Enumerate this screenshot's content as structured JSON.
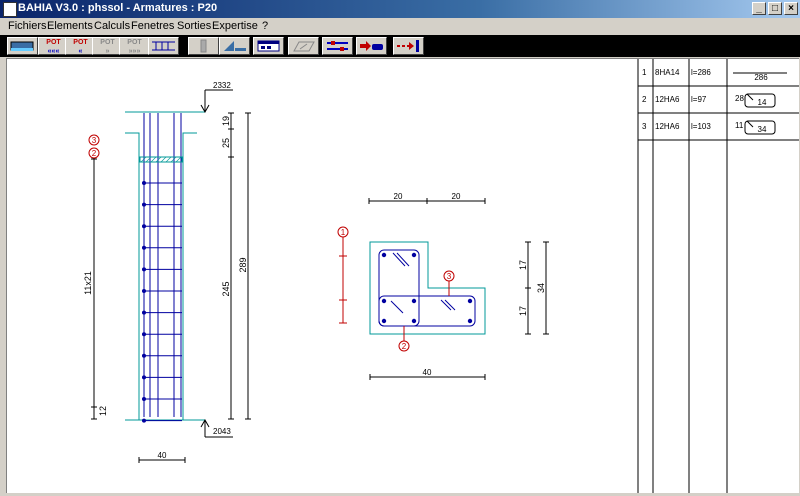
{
  "window": {
    "title": "BAHIA V3.0 : phssol - Armatures : P20",
    "minimize": "_",
    "maximize": "□",
    "close": "×"
  },
  "menu": [
    "Fichiers",
    "Elements",
    "Calculs",
    "Fenetres",
    "Sorties",
    "Expertise",
    "?"
  ],
  "toolbar": {
    "buttons": [
      {
        "name": "beam-view-icon",
        "label": "",
        "state": "enabled"
      },
      {
        "name": "pot-first-icon",
        "label": "POT\n«««",
        "state": "enabled"
      },
      {
        "name": "pot-prev-icon",
        "label": "POT\n«",
        "state": "enabled"
      },
      {
        "name": "pot-next-icon",
        "label": "POT\n»",
        "state": "disabled"
      },
      {
        "name": "pot-last-icon",
        "label": "POT\n»»»",
        "state": "disabled"
      },
      {
        "name": "rebar-layout-icon",
        "label": "",
        "state": "enabled"
      },
      {
        "name": "column-icon",
        "label": "",
        "state": "disabled"
      },
      {
        "name": "section-icon",
        "label": "",
        "state": "enabled"
      },
      {
        "name": "table-icon",
        "label": "",
        "state": "enabled"
      },
      {
        "name": "slab-icon",
        "label": "",
        "state": "disabled"
      },
      {
        "name": "tools-icon",
        "label": "",
        "state": "enabled"
      },
      {
        "name": "export-icon",
        "label": "",
        "state": "enabled"
      },
      {
        "name": "exit-icon",
        "label": "",
        "state": "enabled"
      }
    ]
  },
  "drawing": {
    "elevation": {
      "top_level": "2332",
      "bottom_level": "2043",
      "dim_top_19": "19",
      "dim_25": "25",
      "dim_245": "245",
      "dim_289": "289",
      "dim_12": "12",
      "spacing": "11x21",
      "width": "40",
      "marks": [
        "3",
        "2"
      ]
    },
    "section": {
      "top_dim_left": "20",
      "top_dim_right": "20",
      "bottom_dim": "40",
      "right_dim_top": "17",
      "right_dim_bottom": "17",
      "right_dim_total": "34",
      "marks": [
        "1",
        "2",
        "3"
      ]
    }
  },
  "schedule": {
    "rows": [
      {
        "num": "1",
        "bars": "8HA14",
        "length": "l=286",
        "count": "",
        "shape": "286"
      },
      {
        "num": "2",
        "bars": "12HA6",
        "length": "l=97",
        "count": "28",
        "shape": "14"
      },
      {
        "num": "3",
        "bars": "12HA6",
        "length": "l=103",
        "count": "11",
        "shape": "34"
      }
    ]
  }
}
